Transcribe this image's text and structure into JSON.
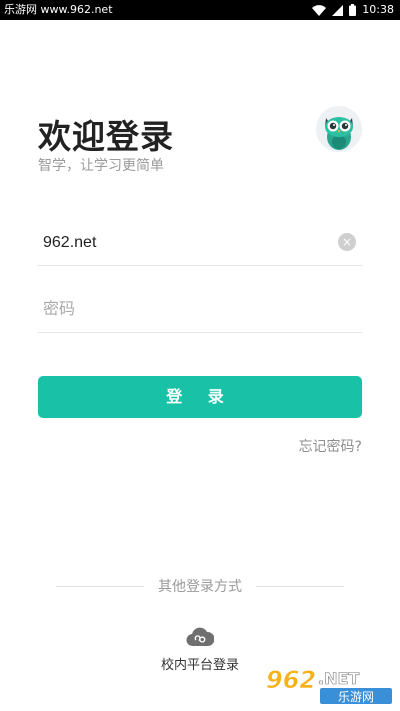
{
  "status_bar": {
    "left_text": "乐游网 www.962.net",
    "time": "10:38"
  },
  "header": {
    "title": "欢迎登录",
    "subtitle": "智学，让学习更简单"
  },
  "form": {
    "account_value": "962.net",
    "password_placeholder": "密码",
    "clear_icon": "×",
    "login_label": "登 录",
    "forgot_label": "忘记密码?"
  },
  "other_login": {
    "divider_label": "其他登录方式",
    "platform_label": "校内平台登录"
  },
  "watermark": {
    "brand": "962.NET",
    "sub": "乐游网"
  },
  "colors": {
    "accent": "#19c2a7",
    "text_primary": "#222222",
    "text_secondary": "#9a9a9a"
  }
}
